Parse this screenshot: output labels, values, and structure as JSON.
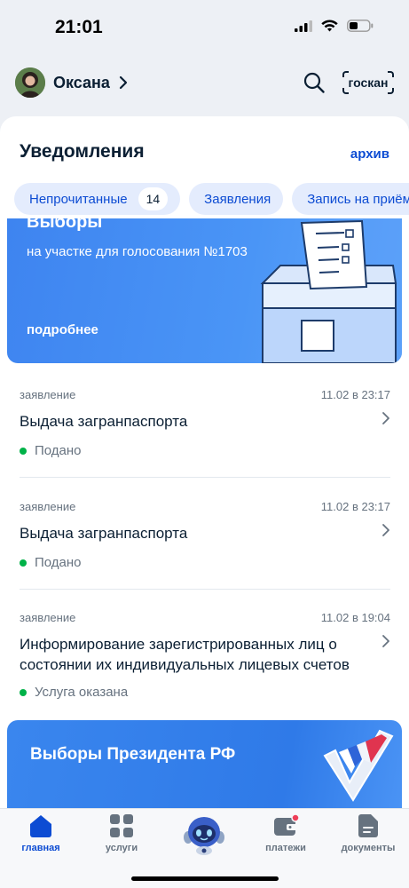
{
  "status_bar": {
    "time": "21:01",
    "icons": [
      "cellular-signal-icon",
      "wifi-icon",
      "battery-icon"
    ]
  },
  "header": {
    "user_name": "Оксана",
    "scan_label": "госкан"
  },
  "notifications": {
    "title": "Уведомления",
    "archive_label": "архив",
    "filters": [
      {
        "label": "Непрочитанные",
        "count": "14"
      },
      {
        "label": "Заявления"
      },
      {
        "label": "Запись на приём"
      }
    ],
    "promo": {
      "title": "Выборы",
      "subtitle": "на участке для голосования №1703",
      "more_label": "подробнее"
    },
    "items": [
      {
        "type": "заявление",
        "date": "11.02 в 23:17",
        "title": "Выдача загранпаспорта",
        "status": "Подано"
      },
      {
        "type": "заявление",
        "date": "11.02 в 23:17",
        "title": "Выдача загранпаспорта",
        "status": "Подано"
      },
      {
        "type": "заявление",
        "date": "11.02 в 19:04",
        "title": "Информирование зарегистрированных лиц о состоянии их индивидуальных лицевых счетов",
        "status": "Услуга оказана"
      }
    ],
    "election_banner": {
      "title": "Выборы Президента РФ"
    }
  },
  "bottom_nav": [
    {
      "label": "главная",
      "icon": "home-icon",
      "active": true
    },
    {
      "label": "услуги",
      "icon": "services-grid-icon"
    },
    {
      "label": "",
      "icon": "robot-assistant-icon"
    },
    {
      "label": "платежи",
      "icon": "wallet-icon",
      "badge": true
    },
    {
      "label": "документы",
      "icon": "document-icon"
    }
  ],
  "colors": {
    "accent": "#0d4cd3",
    "status_green": "#00b248",
    "background": "#edf0f5",
    "badge_red": "#ee3f58"
  }
}
